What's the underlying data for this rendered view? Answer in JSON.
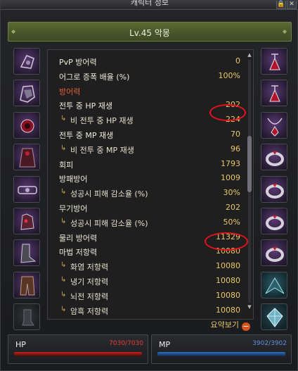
{
  "window": {
    "title": "캐릭터 정보"
  },
  "header": {
    "text": "Lv.45 악몽"
  },
  "stats": [
    {
      "label": "PvP 방어력",
      "value": "0",
      "indent": false,
      "section": false
    },
    {
      "label": "어그로 증폭 배율 (%)",
      "value": "100%",
      "indent": false,
      "section": false
    },
    {
      "label": "방어력",
      "value": "",
      "indent": false,
      "section": true
    },
    {
      "label": "전투 중 HP 재생",
      "value": "202",
      "indent": false,
      "section": false
    },
    {
      "label": "비 전투 중 HP 재생",
      "value": "224",
      "indent": true,
      "section": false
    },
    {
      "label": "전투 중 MP 재생",
      "value": "70",
      "indent": false,
      "section": false
    },
    {
      "label": "비 전투 중 MP 재생",
      "value": "96",
      "indent": true,
      "section": false
    },
    {
      "label": "회피",
      "value": "1793",
      "indent": false,
      "section": false
    },
    {
      "label": "방패방어",
      "value": "1009",
      "indent": false,
      "section": false
    },
    {
      "label": "성공시 피해 감소율 (%)",
      "value": "30%",
      "indent": true,
      "section": false
    },
    {
      "label": "무기방어",
      "value": "202",
      "indent": false,
      "section": false
    },
    {
      "label": "성공시 피해 감소율 (%)",
      "value": "50%",
      "indent": true,
      "section": false
    },
    {
      "label": "물리 방어력",
      "value": "11329",
      "indent": false,
      "section": false
    },
    {
      "label": "마법 저항력",
      "value": "10080",
      "indent": false,
      "section": false
    },
    {
      "label": "화염 저항력",
      "value": "10080",
      "indent": true,
      "section": false
    },
    {
      "label": "냉기 저항력",
      "value": "10080",
      "indent": true,
      "section": false
    },
    {
      "label": "뇌전 저항력",
      "value": "10080",
      "indent": true,
      "section": false
    },
    {
      "label": "암흑 저항력",
      "value": "10080",
      "indent": true,
      "section": false
    }
  ],
  "summary_label": "요약보기",
  "hp": {
    "label": "HP",
    "text": "7030/7030",
    "fraction": 1.0,
    "color": "#c0211d"
  },
  "mp": {
    "label": "MP",
    "text": "3902/3902",
    "fraction": 1.0,
    "color": "#2e6fc4"
  },
  "colors": {
    "value": "#e9c768",
    "section": "#e2613b",
    "highlight": "#e3121b",
    "header": "#4b5a2b"
  },
  "equipment_left": [
    "head-armor-icon",
    "shoulder-armor-icon",
    "chest-armor-icon",
    "cloak-icon",
    "belt-icon",
    "gloves-icon",
    "boots-icon",
    "leggings-icon",
    "empty-slot"
  ],
  "equipment_right": [
    "earring-icon",
    "earring-icon",
    "necklace-icon",
    "ring-icon",
    "ring-icon",
    "ring-icon",
    "ring-icon",
    "wings-icon",
    "crystal-icon"
  ]
}
